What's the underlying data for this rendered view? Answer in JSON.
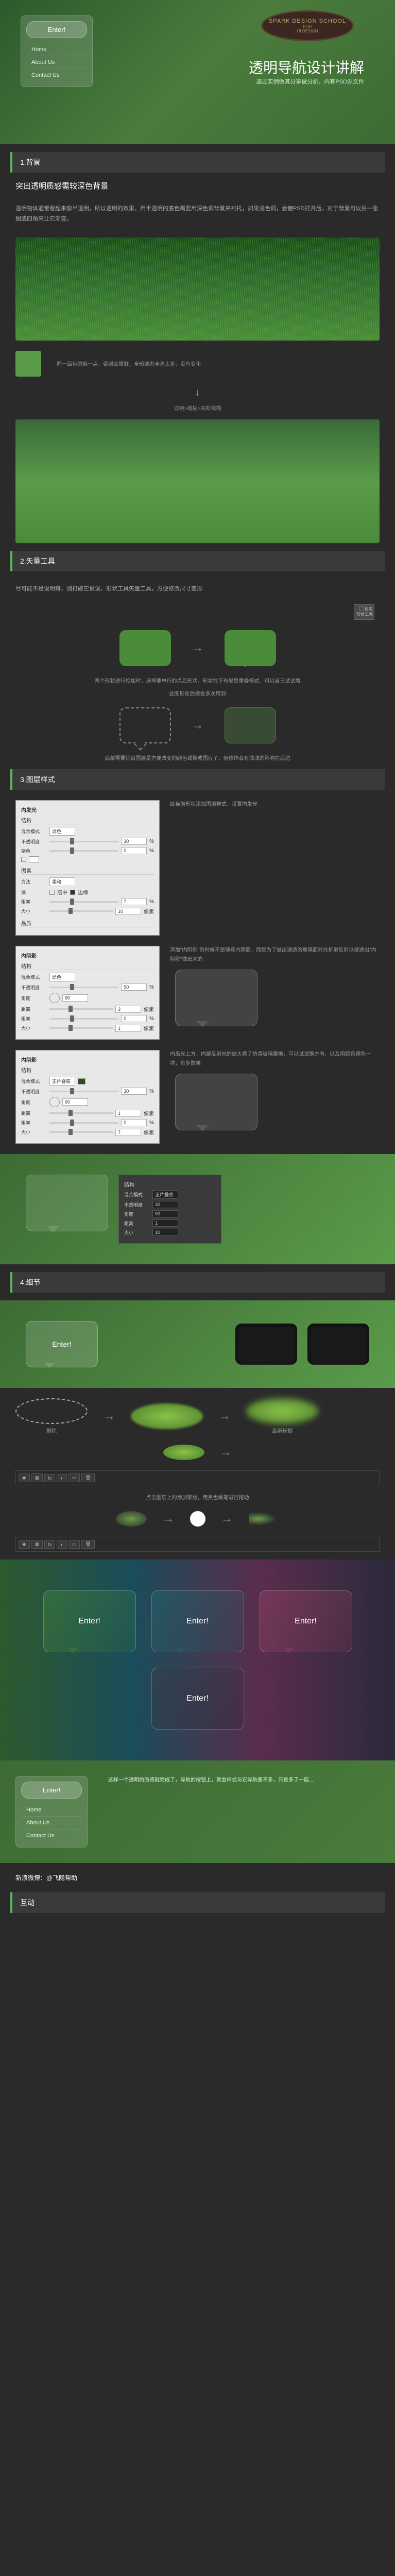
{
  "header": {
    "enter_btn": "Enter!",
    "nav": [
      "Home",
      "About Us",
      "Contact Us"
    ],
    "badge_title": "SPARK DESIGN SCHOOL",
    "badge_for": "FOR",
    "badge_sub": "UI DESIGN",
    "main_title": "透明导航设计讲解",
    "subtitle": "通过实例做其分享做分析，内有PSD源文件"
  },
  "sections": {
    "s1": "1.背景",
    "s2": "2.矢量工具",
    "s3": "3.图层样式",
    "s4": "4.细节",
    "s5": "互动"
  },
  "text": {
    "bg_title": "突出透明质感需较深色背景",
    "bg_desc": "透明物体通常看起来像半透明，所以透明的效果、用半透明的底色需要用深色调背景来衬托，如果浅色调，会使PSD打开后，对于背景可以另一张图或四角来让它渐变。",
    "swatch_text": "同一面色的偏一点，否则会很脏；全暗或者全亮太多，没有变化",
    "arrow1_label": "滤镜>模糊>高斯模糊",
    "vector_intro": "尽可能不是说明嘛，则打破它说说，形状工具矢量工具，方便修改尺寸变形",
    "shape_caption": "两个形状进行相加时，选择要单行的点后形状，形状在下布局是重叠模式，可以自己试试看",
    "shape_caption2": "此图形在后续会多次用到",
    "outline_caption": "底部需要铺首图层是方便改变的颜色或换成图片了，但修饰会有浅浅的影响在后边",
    "panel1_desc": "给当前形状添加图层样式，设置内发光",
    "panel2_desc": "添加\"内阴影\"的时候不是随意内阴影，而是为了做出通透的玻璃面对光折射反射以便透出\"内阴影\"做出来的",
    "panel3_desc": "内高光上方，内部反射光的放大看了仿真玻璃要换，可以试试换方向，以及用颜色调色一块，有多数果",
    "detail_label1": "删除",
    "detail_label2": "高斯模糊",
    "toolbar_caption": "点击图层上的添加蒙版，用黑色画笔进行拖动",
    "final_text": "这样一个透明的质感就完成了，导航的按钮上，就会样式与它导航差不多，只是多了一层...",
    "credit": "新浪微博：@飞隐帮助",
    "enter_label": "Enter!"
  },
  "ps_panel": {
    "structure": "结构",
    "blend_mode": "混合模式",
    "screen": "滤色",
    "opacity": "不透明度",
    "noise": "杂色",
    "elements": "图素",
    "method": "方法",
    "softer": "柔和",
    "source": "源",
    "center": "居中",
    "edge": "边缘",
    "choke": "阻塞",
    "size": "大小",
    "quality": "品质",
    "distance": "距离",
    "angle": "角度",
    "px": "像素",
    "percent": "%",
    "multiply": "正片叠底",
    "inner_shadow": "内阴影",
    "inner_glow": "内发光",
    "val_30": "30",
    "val_0": "0",
    "val_7": "7",
    "val_10": "10",
    "val_50": "50",
    "val_90": "90",
    "val_3": "3",
    "val_1": "1"
  }
}
